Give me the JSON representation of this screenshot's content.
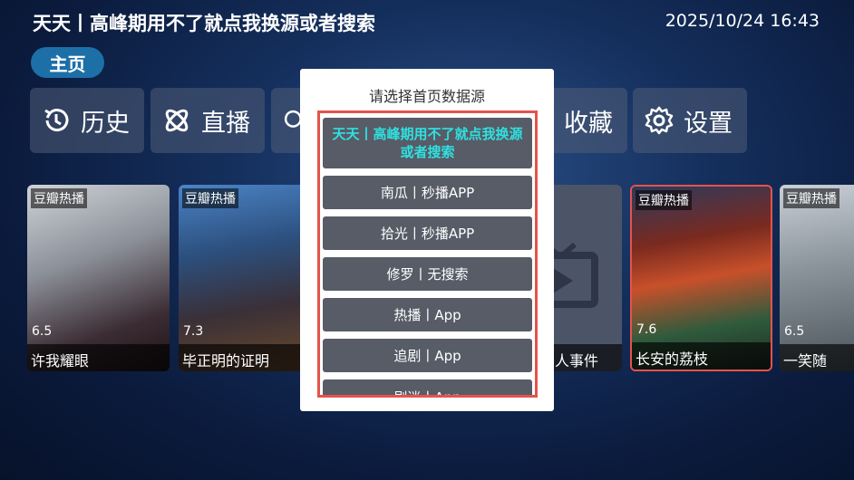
{
  "header": {
    "title": "天天丨高峰期用不了就点我换源或者搜索",
    "datetime": "2025/10/24 16:43",
    "home_tab": "主页"
  },
  "nav": {
    "history": "历史",
    "live": "直播",
    "favorites": "收藏",
    "settings": "设置"
  },
  "cards": [
    {
      "badge": "豆瓣热播",
      "score": "6.5",
      "title": "许我耀眼"
    },
    {
      "badge": "豆瓣热播",
      "score": "7.3",
      "title": "毕正明的证明"
    },
    {
      "badge": "",
      "score": "",
      "title": "杀人事件"
    },
    {
      "badge": "豆瓣热播",
      "score": "7.6",
      "title": "长安的荔枝"
    },
    {
      "badge": "豆瓣热播",
      "score": "6.5",
      "title": "一笑随"
    }
  ],
  "dialog": {
    "title": "请选择首页数据源",
    "options": [
      "天天丨高峰期用不了就点我换源或者搜索",
      "南瓜丨秒播APP",
      "拾光丨秒播APP",
      "修罗丨无搜索",
      "热播丨App",
      "追剧丨App",
      "剧迷丨App"
    ],
    "selected_index": 0
  },
  "colors": {
    "accent": "#1d6fa8",
    "selected_text": "#2fe0e0",
    "frame": "#e5534b"
  }
}
